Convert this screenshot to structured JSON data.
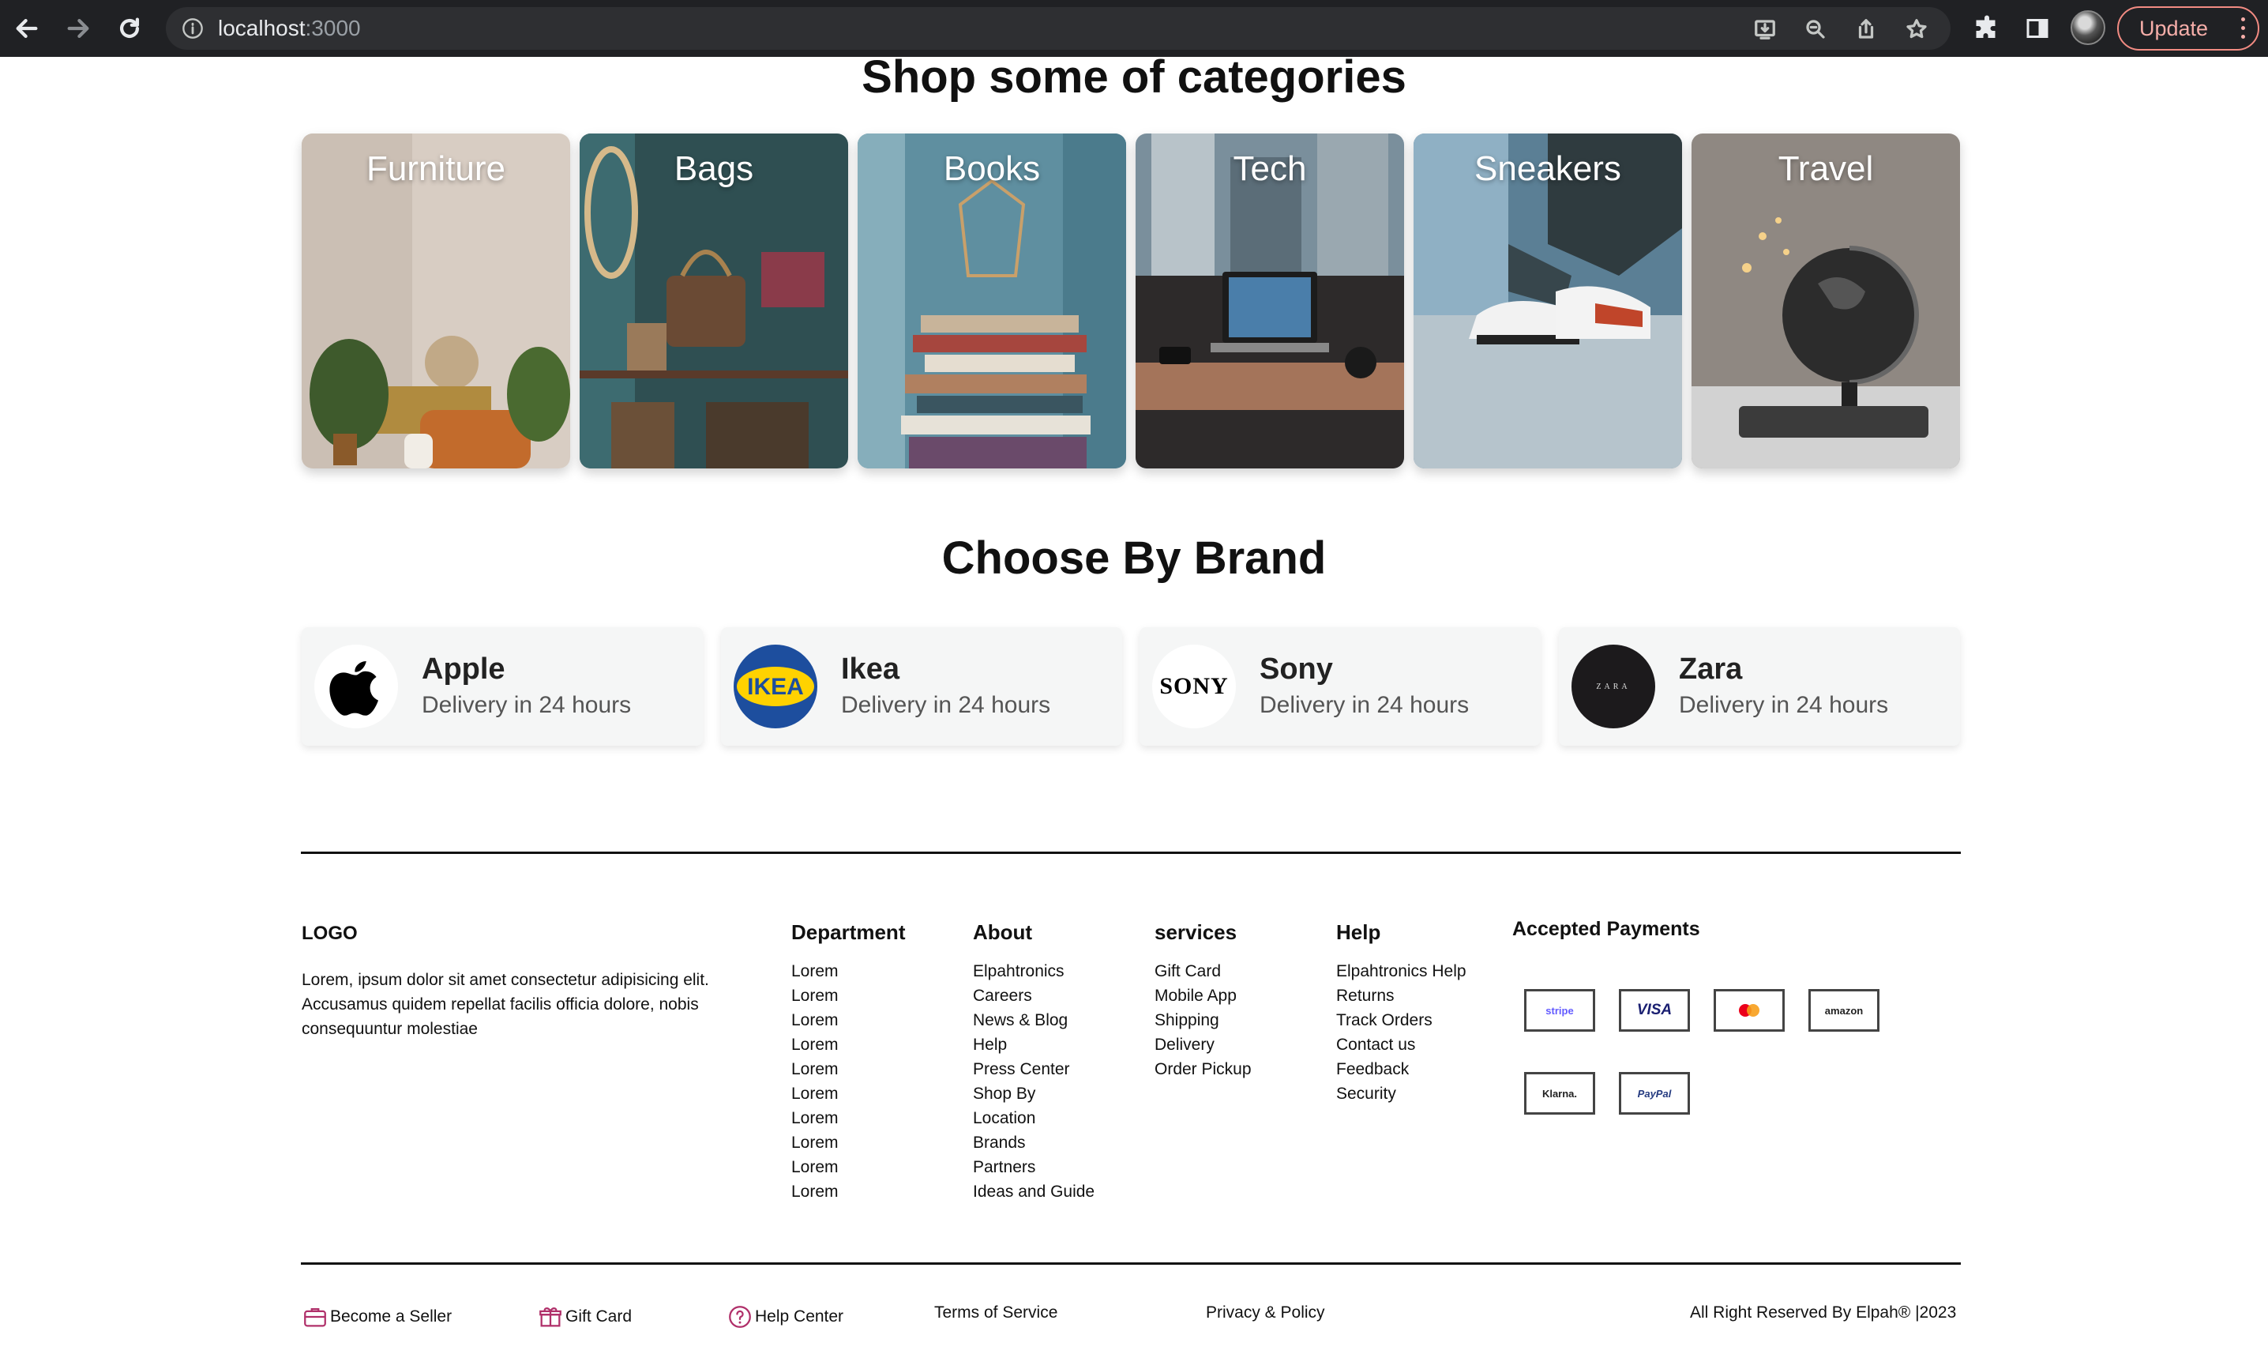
{
  "browser": {
    "url_host": "localhost",
    "url_port": ":3000",
    "update_label": "Update"
  },
  "categories": {
    "title": "Shop some of categories",
    "items": [
      {
        "label": "Furniture"
      },
      {
        "label": "Bags"
      },
      {
        "label": "Books"
      },
      {
        "label": "Tech"
      },
      {
        "label": "Sneakers"
      },
      {
        "label": "Travel"
      }
    ]
  },
  "brands": {
    "title": "Choose By Brand",
    "items": [
      {
        "name": "Apple",
        "subtitle": "Delivery in 24 hours",
        "logo": "apple-logo"
      },
      {
        "name": "Ikea",
        "subtitle": "Delivery in 24 hours",
        "logo": "IKEA"
      },
      {
        "name": "Sony",
        "subtitle": "Delivery in 24 hours",
        "logo": "SONY"
      },
      {
        "name": "Zara",
        "subtitle": "Delivery in 24 hours",
        "logo": "ZARA"
      }
    ]
  },
  "footer": {
    "logo": "LOGO",
    "description": "Lorem, ipsum dolor sit amet consectetur adipisicing elit. Accusamus quidem repellat facilis officia dolore, nobis consequuntur molestiae",
    "columns": [
      {
        "title": "Department",
        "links": [
          "Lorem",
          "Lorem",
          "Lorem",
          "Lorem",
          "Lorem",
          "Lorem",
          "Lorem",
          "Lorem",
          "Lorem",
          "Lorem"
        ]
      },
      {
        "title": "About",
        "links": [
          "Elpahtronics",
          "Careers",
          "News & Blog",
          "Help",
          "Press Center",
          "Shop By",
          "Location",
          "Brands",
          "Partners",
          "Ideas and Guide"
        ]
      },
      {
        "title": "services",
        "links": [
          "Gift Card",
          "Mobile App",
          "Shipping",
          "Delivery",
          "Order Pickup"
        ]
      },
      {
        "title": "Help",
        "links": [
          "Elpahtronics Help",
          "Returns",
          "Track Orders",
          "Contact us",
          "Feedback",
          "Security"
        ]
      }
    ],
    "payments": {
      "title": "Accepted Payments",
      "methods": [
        "stripe",
        "VISA",
        "mastercard",
        "amazon",
        "Klarna.",
        "PayPal"
      ]
    },
    "bottom": {
      "seller": "Become a Seller",
      "gift": "Gift Card",
      "help": "Help Center",
      "terms": "Terms of Service",
      "privacy": "Privacy & Policy",
      "copyright": "All Right Reserved By Elpah® |2023"
    }
  },
  "colors": {
    "chrome_bg": "#202124",
    "accent_icon": "#b0306a",
    "brand_card_bg": "#f5f6f6"
  }
}
